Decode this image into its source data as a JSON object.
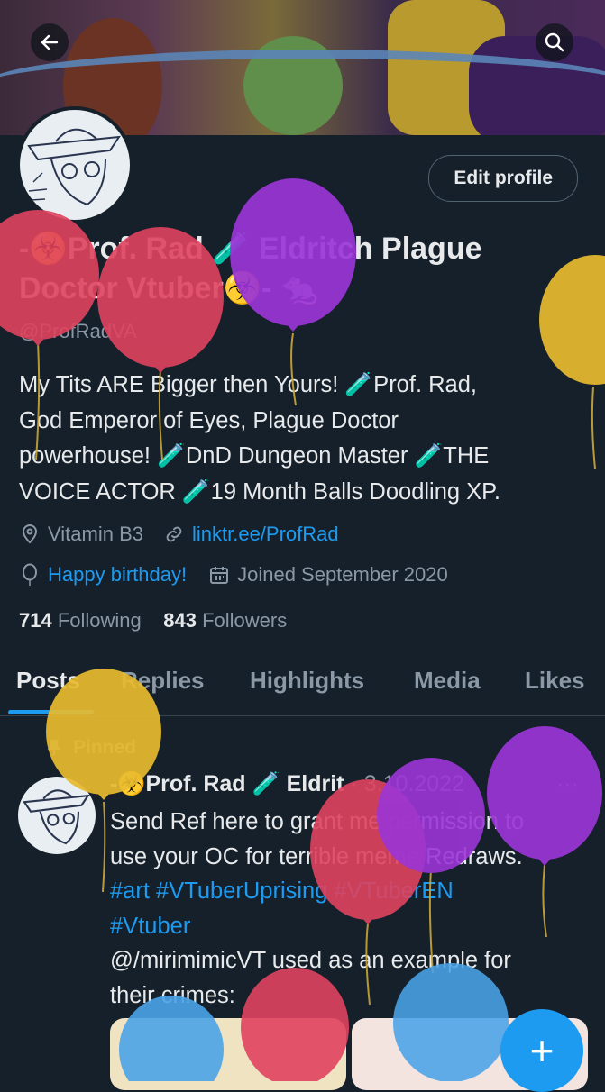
{
  "header": {
    "back_icon": "arrow-left-icon",
    "search_icon": "search-icon"
  },
  "profile": {
    "edit_label": "Edit profile",
    "name_line1": "-☣️Prof. Rad 🧪 Eldritch Plague",
    "name_line2": "Doctor Vtuber☣️- 🐀",
    "handle": "@ProfRadVA",
    "bio": [
      "My Tits ARE Bigger then Yours! 🧪Prof. Rad,",
      "God Emperor of Eyes, Plague Doctor",
      "powerhouse! 🧪DnD Dungeon Master 🧪THE",
      "VOICE ACTOR 🧪19 Month Balls Doodling XP."
    ],
    "location": "Vitamin B3",
    "link": "linktr.ee/ProfRad",
    "birthday": "Happy birthday!",
    "joined": "Joined September 2020",
    "following_count": "714",
    "following_label": "Following",
    "followers_count": "843",
    "followers_label": "Followers"
  },
  "tabs": [
    "Posts",
    "Replies",
    "Highlights",
    "Media",
    "Likes"
  ],
  "post": {
    "pinned_label": "Pinned",
    "author": "-☣️Prof. Rad 🧪 Eldrit",
    "date": "· 3.10.2022",
    "more": "···",
    "line1": "Send Ref here to grant me permission to",
    "line2": "use your OC for terrible meme Redraws.",
    "tags1": "#art #VTuberUprising #VTuberEN",
    "tags2": "#Vtuber",
    "line3": "@/mirimimicVT used as an example for",
    "line4": "their crimes:"
  },
  "fab_label": "+",
  "colors": {
    "accent": "#1d9bf0",
    "background": "#15202b",
    "muted": "#8b98a5",
    "balloon_red": "#e0435f",
    "balloon_purple": "#9b35d6",
    "balloon_yellow": "#e8bb2e",
    "balloon_blue": "#4aa3e8"
  }
}
